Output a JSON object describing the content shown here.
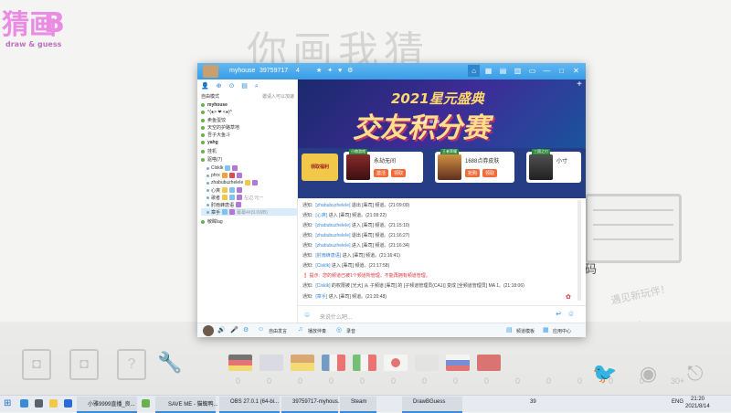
{
  "background": {
    "logo": {
      "line1": "猜画",
      "line2": "B",
      "line3": "draw & guess"
    },
    "title": "你画我猜",
    "code_label": "码",
    "new_players": "遇见新玩伴！",
    "score_numbers": [
      "0",
      "0",
      "0",
      "0",
      "0",
      "0",
      "0",
      "0",
      "0",
      "0",
      "0",
      "0",
      "0",
      "0",
      "30+"
    ]
  },
  "window": {
    "title_name": "myhouse",
    "room_id": "39759717",
    "user_count": "4",
    "title_icons": "★ ✦ ♥ ⚙",
    "title_buttons": [
      "⌂",
      "▦",
      "▤",
      "▥",
      "▭",
      "—",
      "□",
      "✕"
    ]
  },
  "left_panel": {
    "tools": "👤 ⊕ ⊙ ▤ ⌕",
    "mode_label": "自由模式",
    "invite_label": "邀请入可以加速",
    "channels": [
      {
        "name": "myhouse"
      },
      {
        "name": "^(●> ❤ <●)^"
      },
      {
        "name": "卖鱼蛋饺"
      },
      {
        "name": "天空的护路草地"
      },
      {
        "name": "吾子大鱼斗"
      },
      {
        "name": "yahg"
      },
      {
        "name": "挂机"
      },
      {
        "name": "驱嗒(7)"
      }
    ],
    "users": [
      {
        "name": "Clsklk"
      },
      {
        "name": "phrx"
      },
      {
        "name": "zhabubuzheleIe"
      },
      {
        "name": "心爽"
      },
      {
        "name": "歌者",
        "status": "左边 元一"
      },
      {
        "name": "肘雨蜂唐语"
      },
      {
        "name": "章手",
        "status": "幕幕4#(9.6WB)"
      }
    ],
    "extra_channel": "敏眸lag"
  },
  "banner": {
    "year_text": "2021星元盛典",
    "main_text": "交友积分赛",
    "plus": "+",
    "gift_label": "领取福利",
    "cards": [
      {
        "tag": "小赫游戏",
        "title": "永劫无间",
        "btn1": "激活",
        "btn2": "领取"
      },
      {
        "tag": "王者荣耀",
        "title": "1688点券皮肤",
        "btn1": "抢购",
        "btn2": "领取"
      },
      {
        "tag": "三国之刃",
        "title": "小寸",
        "btn1": "",
        "btn2": ""
      }
    ]
  },
  "chat": {
    "messages": [
      {
        "sys": "通知:",
        "user": "[zhabubuzheleIe]",
        "text": "退出 [辈司] 频道。(21:09:09)",
        "warn": false
      },
      {
        "sys": "通知:",
        "user": "[心爽]",
        "text": "进入 [辈司] 频道。(21:09:22)",
        "warn": false
      },
      {
        "sys": "通知:",
        "user": "[zhabubuzheleIe]",
        "text": "进入 [辈司] 频道。(21:15:10)",
        "warn": false
      },
      {
        "sys": "通知:",
        "user": "[zhabubuzheleIe]",
        "text": "退出 [辈司] 频道。(21:16:27)",
        "warn": false
      },
      {
        "sys": "通知:",
        "user": "[zhabubuzheleIe]",
        "text": "进入 [辈司] 频道。(21:16:34)",
        "warn": false
      },
      {
        "sys": "通知:",
        "user": "[肘雨蜂唐语]",
        "text": "进入 [辈司] 频道。(21:16:41)",
        "warn": false
      },
      {
        "sys": "通知:",
        "user": "[Clsklk]",
        "text": "进入 [辈司] 频道。(21:17:58)",
        "warn": false
      },
      {
        "sys": "❗ 提示:",
        "user": "",
        "text": "您的频道已被1个频道所管理，不能再拥有频道管理。",
        "warn": true
      },
      {
        "sys": "通知:",
        "user": "[Clsklk]",
        "text": "的权限被 [光大] 从 子频道 [辈司] 的 [子频道管理员(CA1)] 变成 [全频道管理员] MA 1。(21:18:06)",
        "warn": false
      },
      {
        "sys": "通知:",
        "user": "[章手]",
        "text": "进入 [辈司] 频道。(21:20:48)",
        "warn": false
      }
    ],
    "input_placeholder": "来说什么吧..."
  },
  "bottom_bar": {
    "free_speak": "自由发言",
    "music": "播放伴奏",
    "record": "录音",
    "channel_template": "频道模板",
    "app_center": "应用中心"
  },
  "taskbar": {
    "items": [
      {
        "label": "小雅9999直播_良..."
      },
      {
        "label": "SAVE ME - 猫蜘鸭..."
      },
      {
        "label": "OBS 27.0.1 (64-bi..."
      },
      {
        "label": "39759717-myhous..."
      },
      {
        "label": "Steam"
      },
      {
        "label": "DrawBGuess"
      }
    ],
    "tray_num": "39",
    "lang": "ENG",
    "time": "21:20",
    "date": "2021/8/14"
  },
  "colors": {
    "accent": "#3a9de6",
    "titlebar": "#61b8f1",
    "warn": "#d9363e",
    "logo": "#e98ce3"
  }
}
